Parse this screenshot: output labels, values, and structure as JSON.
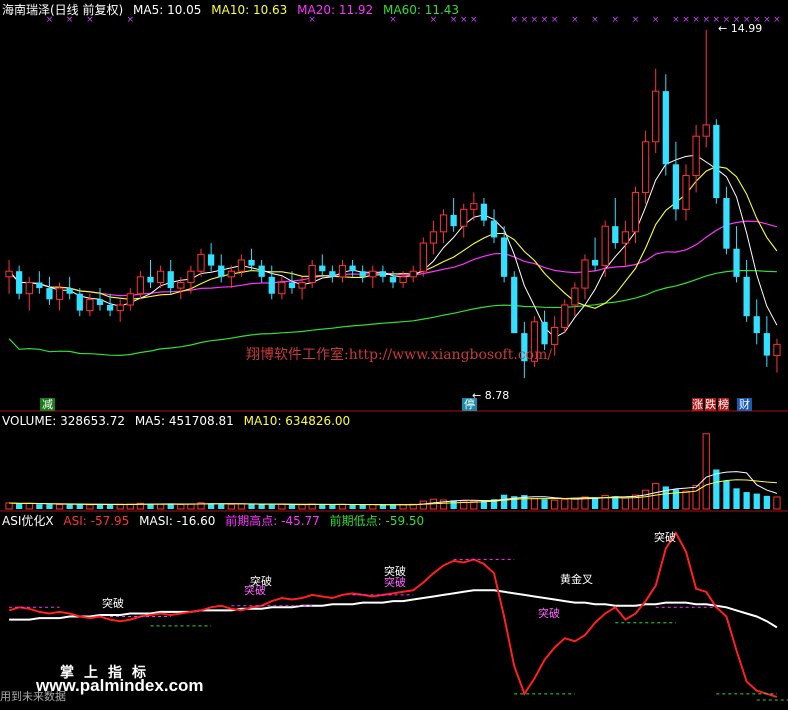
{
  "header": {
    "stock": "海南瑞泽(日线 前复权)",
    "ma5": "MA5: 10.05",
    "ma10": "MA10: 10.63",
    "ma20": "MA20: 11.92",
    "ma60": "MA60: 11.43"
  },
  "volume_header": {
    "volume": "VOLUME: 328653.72",
    "ma5": "MA5: 451708.81",
    "ma10": "MA10: 634826.00"
  },
  "asi_header": {
    "name": "ASI优化X",
    "asi": "ASI: -57.95",
    "masi": "MASI: -16.60",
    "prev_high": "前期高点: -45.77",
    "prev_low": "前期低点: -59.50"
  },
  "price_labels": {
    "high": "14.99",
    "low": "8.78"
  },
  "event_tags": {
    "jian": "减",
    "ting": "停",
    "zhang": "涨",
    "die": "跌",
    "bang": "榜",
    "cai": "财"
  },
  "asi_annotations": {
    "break1": "突破",
    "break2": "突破",
    "break3": "突破",
    "break4": "突破",
    "break5": "突破",
    "break6": "突破",
    "break7": "突破",
    "gold_cross": "黄金叉"
  },
  "watermark": "翔博软件工作室:http://www.xiangbosoft.com/",
  "logo": {
    "title": "掌上指标",
    "url": "www.palmindex.com",
    "subtitle": "用到未来数据"
  },
  "colors": {
    "up": "#ff3333",
    "down": "#33e0ff",
    "ma5": "#ffffff",
    "ma10": "#ffff33",
    "ma20": "#ff33ff",
    "ma60": "#33dd33",
    "asi": "#ff2020",
    "masi": "#ffffff",
    "divider": "#aa1111"
  },
  "chart_data": {
    "type": "candlestick",
    "price_range": [
      8.5,
      15.2
    ],
    "ohlc": [
      [
        10.6,
        10.9,
        10.3,
        10.7
      ],
      [
        10.7,
        10.8,
        10.2,
        10.3
      ],
      [
        10.3,
        10.6,
        10.0,
        10.5
      ],
      [
        10.5,
        10.7,
        10.3,
        10.4
      ],
      [
        10.4,
        10.6,
        10.1,
        10.2
      ],
      [
        10.2,
        10.5,
        10.0,
        10.4
      ],
      [
        10.4,
        10.6,
        10.2,
        10.3
      ],
      [
        10.3,
        10.4,
        9.9,
        10.0
      ],
      [
        10.0,
        10.3,
        9.9,
        10.2
      ],
      [
        10.2,
        10.4,
        10.0,
        10.1
      ],
      [
        10.1,
        10.3,
        9.9,
        10.0
      ],
      [
        10.0,
        10.2,
        9.8,
        10.1
      ],
      [
        10.1,
        10.4,
        10.0,
        10.3
      ],
      [
        10.3,
        10.7,
        10.2,
        10.6
      ],
      [
        10.6,
        10.9,
        10.4,
        10.5
      ],
      [
        10.5,
        10.8,
        10.4,
        10.7
      ],
      [
        10.7,
        10.9,
        10.3,
        10.4
      ],
      [
        10.4,
        10.6,
        10.2,
        10.5
      ],
      [
        10.5,
        10.8,
        10.3,
        10.7
      ],
      [
        10.7,
        11.1,
        10.6,
        11.0
      ],
      [
        11.0,
        11.2,
        10.7,
        10.8
      ],
      [
        10.8,
        11.0,
        10.5,
        10.6
      ],
      [
        10.6,
        10.8,
        10.4,
        10.7
      ],
      [
        10.7,
        11.0,
        10.6,
        10.9
      ],
      [
        10.9,
        11.1,
        10.7,
        10.8
      ],
      [
        10.8,
        10.9,
        10.5,
        10.6
      ],
      [
        10.6,
        10.8,
        10.2,
        10.3
      ],
      [
        10.3,
        10.6,
        10.2,
        10.5
      ],
      [
        10.5,
        10.7,
        10.3,
        10.4
      ],
      [
        10.4,
        10.6,
        10.2,
        10.5
      ],
      [
        10.5,
        10.9,
        10.4,
        10.8
      ],
      [
        10.8,
        11.0,
        10.6,
        10.7
      ],
      [
        10.7,
        10.8,
        10.5,
        10.6
      ],
      [
        10.6,
        10.9,
        10.5,
        10.8
      ],
      [
        10.8,
        10.9,
        10.6,
        10.7
      ],
      [
        10.7,
        10.8,
        10.5,
        10.6
      ],
      [
        10.6,
        10.8,
        10.4,
        10.7
      ],
      [
        10.7,
        10.8,
        10.5,
        10.6
      ],
      [
        10.6,
        10.7,
        10.4,
        10.5
      ],
      [
        10.5,
        10.7,
        10.4,
        10.6
      ],
      [
        10.6,
        10.8,
        10.5,
        10.7
      ],
      [
        10.7,
        11.3,
        10.6,
        11.2
      ],
      [
        11.2,
        11.6,
        11.0,
        11.4
      ],
      [
        11.4,
        11.8,
        11.2,
        11.7
      ],
      [
        11.7,
        12.0,
        11.4,
        11.5
      ],
      [
        11.5,
        11.9,
        11.3,
        11.8
      ],
      [
        11.8,
        12.1,
        11.6,
        11.9
      ],
      [
        11.9,
        12.0,
        11.5,
        11.6
      ],
      [
        11.6,
        11.8,
        11.2,
        11.3
      ],
      [
        11.3,
        11.5,
        10.5,
        10.6
      ],
      [
        10.6,
        10.7,
        9.6,
        9.6
      ],
      [
        9.6,
        9.8,
        8.8,
        9.1
      ],
      [
        9.1,
        9.9,
        9.0,
        9.8
      ],
      [
        9.8,
        10.0,
        9.3,
        9.4
      ],
      [
        9.4,
        9.9,
        9.2,
        9.7
      ],
      [
        9.7,
        10.2,
        9.6,
        10.1
      ],
      [
        10.1,
        10.5,
        9.9,
        10.4
      ],
      [
        10.4,
        11.0,
        10.2,
        10.9
      ],
      [
        10.9,
        11.3,
        10.7,
        10.8
      ],
      [
        10.8,
        11.6,
        10.6,
        11.5
      ],
      [
        11.5,
        12.0,
        11.1,
        11.2
      ],
      [
        11.2,
        11.6,
        10.8,
        11.4
      ],
      [
        11.4,
        12.2,
        11.2,
        12.1
      ],
      [
        12.1,
        13.2,
        11.9,
        13.0
      ],
      [
        13.0,
        14.3,
        12.8,
        13.9
      ],
      [
        13.9,
        14.2,
        12.4,
        12.6
      ],
      [
        12.6,
        13.0,
        11.6,
        11.8
      ],
      [
        11.8,
        12.6,
        11.6,
        12.4
      ],
      [
        12.4,
        13.3,
        12.1,
        13.1
      ],
      [
        13.1,
        14.99,
        12.9,
        13.3
      ],
      [
        13.3,
        13.4,
        11.9,
        12.0
      ],
      [
        12.0,
        12.2,
        11.0,
        11.1
      ],
      [
        11.1,
        11.5,
        10.5,
        10.6
      ],
      [
        10.6,
        10.9,
        9.8,
        9.9
      ],
      [
        9.9,
        10.2,
        9.4,
        9.6
      ],
      [
        9.6,
        9.9,
        9.0,
        9.2
      ],
      [
        9.2,
        9.5,
        8.9,
        9.4
      ]
    ],
    "volume_range": [
      0,
      4200000
    ],
    "volume": [
      320000,
      280000,
      300000,
      260000,
      250000,
      240000,
      230000,
      260000,
      220000,
      250000,
      240000,
      230000,
      260000,
      300000,
      280000,
      260000,
      250000,
      240000,
      270000,
      330000,
      300000,
      260000,
      250000,
      270000,
      260000,
      240000,
      230000,
      250000,
      220000,
      240000,
      260000,
      250000,
      230000,
      240000,
      220000,
      230000,
      240000,
      220000,
      210000,
      230000,
      250000,
      420000,
      520000,
      480000,
      460000,
      430000,
      410000,
      440000,
      520000,
      760000,
      680000,
      740000,
      560000,
      520000,
      470000,
      500000,
      580000,
      640000,
      600000,
      720000,
      680000,
      600000,
      740000,
      1000000,
      1350000,
      1200000,
      1050000,
      950000,
      1250000,
      4000000,
      2100000,
      1500000,
      1100000,
      900000,
      820000,
      700000,
      640000
    ],
    "asi_range": [
      -62,
      48
    ],
    "asi": [
      -4,
      -2,
      -3,
      -5,
      -6,
      -5,
      -6,
      -8,
      -9,
      -8,
      -10,
      -11,
      -10,
      -8,
      -7,
      -6,
      -7,
      -6,
      -5,
      -4,
      -2,
      -1,
      -3,
      -4,
      -2,
      -1,
      2,
      4,
      3,
      4,
      6,
      5,
      4,
      6,
      7,
      6,
      5,
      6,
      7,
      8,
      9,
      14,
      20,
      25,
      28,
      27,
      29,
      26,
      20,
      -8,
      -40,
      -58,
      -48,
      -36,
      -28,
      -22,
      -24,
      -20,
      -12,
      -6,
      -2,
      -10,
      -6,
      2,
      12,
      36,
      46,
      34,
      10,
      8,
      -2,
      -8,
      -30,
      -50,
      -56,
      -58,
      -60
    ],
    "masi": [
      -10,
      -10,
      -10,
      -9,
      -9,
      -9,
      -8,
      -8,
      -8,
      -7,
      -7,
      -7,
      -6,
      -6,
      -6,
      -5,
      -5,
      -5,
      -5,
      -4,
      -4,
      -4,
      -4,
      -3,
      -3,
      -3,
      -2,
      -2,
      -2,
      -1,
      -1,
      -1,
      0,
      0,
      0,
      1,
      1,
      1,
      2,
      2,
      3,
      4,
      5,
      6,
      7,
      8,
      9,
      9,
      9,
      8,
      7,
      6,
      5,
      4,
      3,
      2,
      1,
      1,
      0,
      0,
      -1,
      -1,
      -1,
      0,
      0,
      1,
      1,
      1,
      0,
      0,
      -1,
      -2,
      -4,
      -6,
      -8,
      -11,
      -15
    ]
  }
}
